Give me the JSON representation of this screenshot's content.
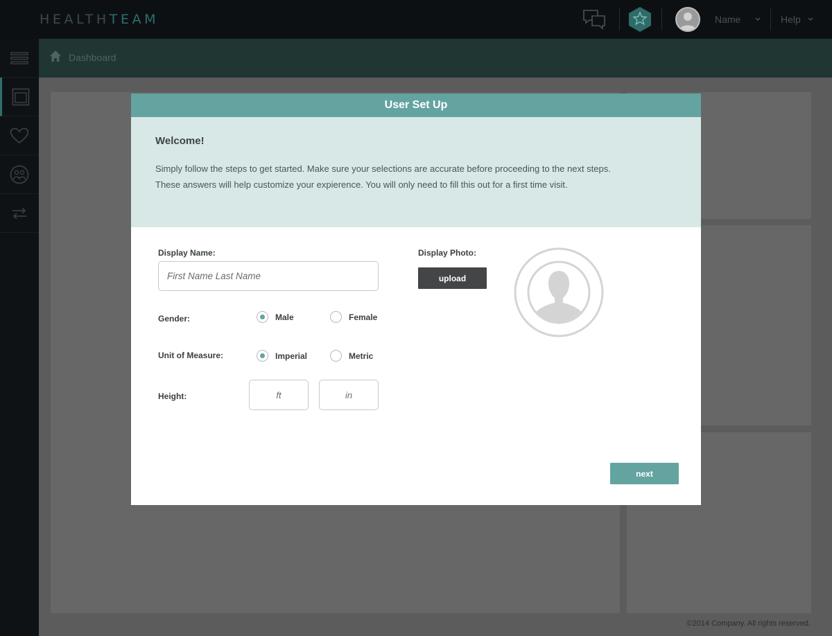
{
  "app": {
    "logo_part1": "HEALTH",
    "logo_part2": "TEAM"
  },
  "topbar": {
    "user_name": "Name",
    "help_label": "Help",
    "icons": [
      "chat-icon",
      "star-badge-icon",
      "user-avatar"
    ]
  },
  "sidebar": {
    "items": [
      "menu-icon",
      "dashboard-icon",
      "heart-icon",
      "people-icon",
      "sync-icon"
    ]
  },
  "breadcrumb": {
    "label": "Dashboard"
  },
  "modal": {
    "title": "User Set Up",
    "welcome": "Welcome!",
    "intro_line1": "Simply follow the steps to get started. Make sure your selections are accurate before proceeding to the next steps.",
    "intro_line2": "These answers will help customize your expierence. You will only need to fill this out for a first time visit.",
    "display_name_label": "Display Name:",
    "display_name_placeholder": "First Name Last Name",
    "gender_label": "Gender:",
    "gender_options": [
      "Male",
      "Female"
    ],
    "gender_selected": "Male",
    "unit_label": "Unit of Measure:",
    "unit_options": [
      "Imperial",
      "Metric"
    ],
    "unit_selected": "Imperial",
    "height_label": "Height:",
    "height_ft_placeholder": "ft",
    "height_in_placeholder": "in",
    "photo_label": "Display Photo:",
    "upload_label": "upload",
    "next_label": "next"
  },
  "footer": {
    "copyright": "©2014 Company. All rights reserved."
  },
  "colors": {
    "accent": "#63a4a1",
    "intro_bg": "#d8e8e7",
    "topbar_bg": "#0d1013",
    "breadcrumb_bg": "#1f3632"
  }
}
